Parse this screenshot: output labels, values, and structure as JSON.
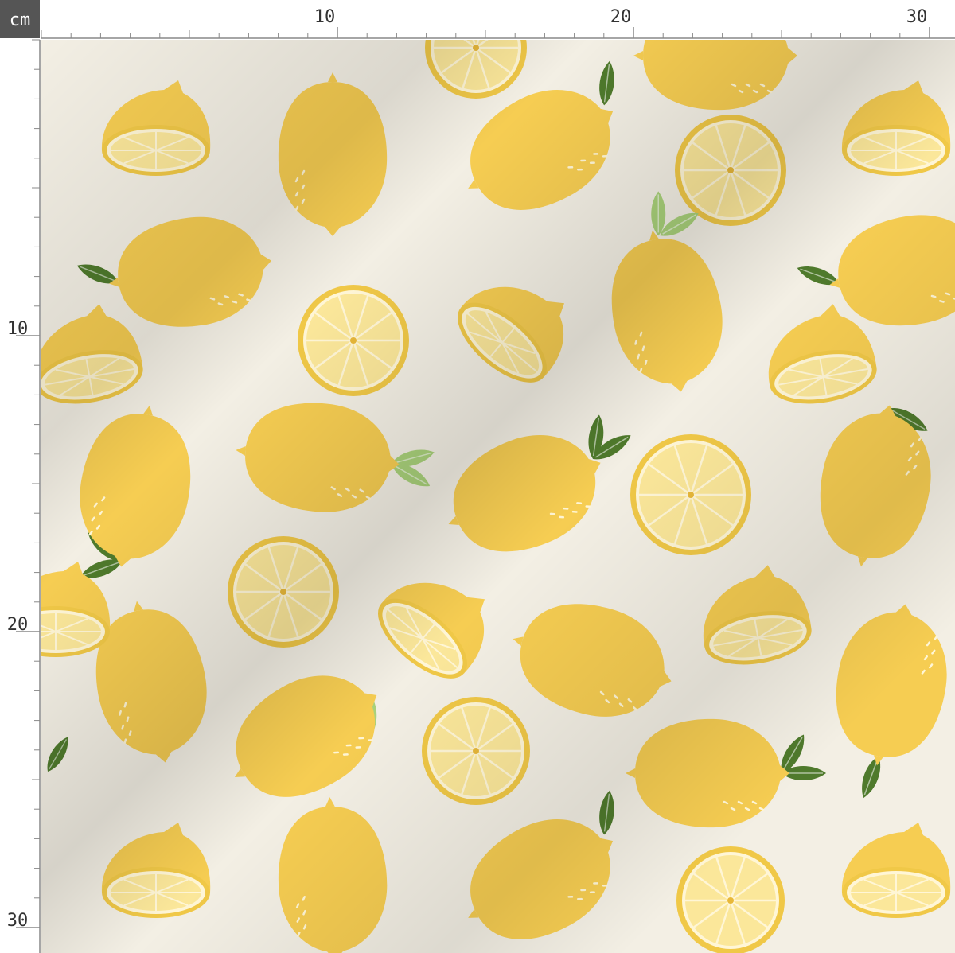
{
  "ruler": {
    "unit_label": "cm",
    "top_labels": [
      "10",
      "20",
      "30"
    ],
    "left_labels": [
      "10",
      "20",
      "30"
    ]
  },
  "colors": {
    "fabric": "#f3efe4",
    "lemon": "#f6cd52",
    "lemon_light": "#fbe07a",
    "flesh": "#fbe79a",
    "rind": "#f0c847",
    "pith": "#fff6d6",
    "leaf_dark": "#4f7a2c",
    "leaf_light": "#a9d17a",
    "ruler_bg": "#ffffff",
    "ruler_tick": "#888888",
    "unit_box": "#555555"
  },
  "pattern": {
    "motifs": [
      "lemon-icon",
      "lemon-half-icon",
      "lemon-slice-icon",
      "leaf-icon"
    ]
  }
}
